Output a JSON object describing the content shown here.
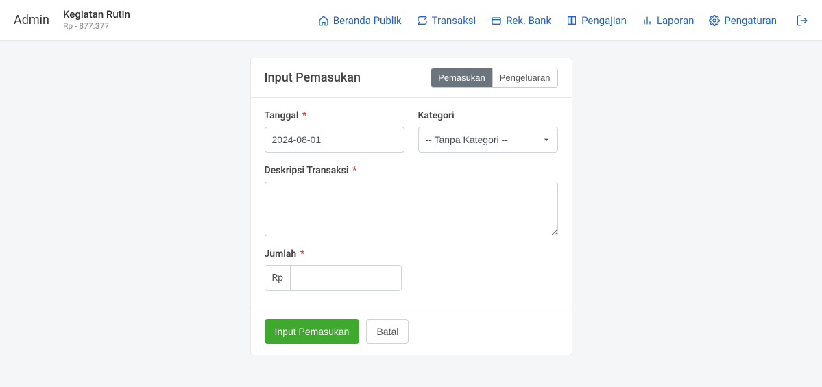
{
  "topbar": {
    "admin": "Admin",
    "org_title": "Kegiatan Rutin",
    "org_sub": "Rp - 877.377",
    "nav": {
      "beranda": "Beranda Publik",
      "transaksi": "Transaksi",
      "rek_bank": "Rek. Bank",
      "pengajian": "Pengajian",
      "laporan": "Laporan",
      "pengaturan": "Pengaturan"
    }
  },
  "card": {
    "title": "Input Pemasukan",
    "toggle": {
      "pemasukan": "Pemasukan",
      "pengeluaran": "Pengeluaran"
    }
  },
  "form": {
    "tanggal_label": "Tanggal",
    "tanggal_value": "2024-08-01",
    "kategori_label": "Kategori",
    "kategori_selected": "-- Tanpa Kategori --",
    "deskripsi_label": "Deskripsi Transaksi",
    "deskripsi_value": "",
    "jumlah_label": "Jumlah",
    "jumlah_prefix": "Rp",
    "jumlah_value": ""
  },
  "footer": {
    "submit": "Input Pemasukan",
    "cancel": "Batal"
  }
}
